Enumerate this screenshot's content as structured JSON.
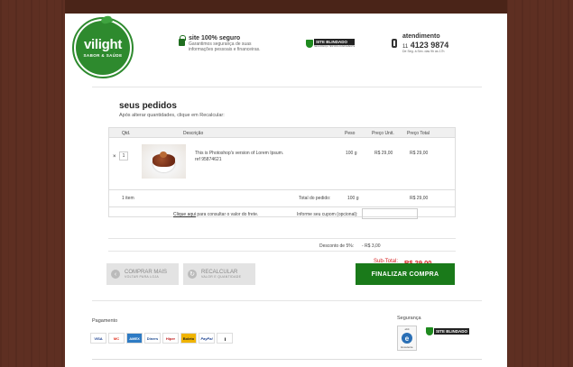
{
  "header": {
    "logo_name": "vilight",
    "logo_tagline": "SABOR & SAÚDE",
    "secure_title": "site 100% seguro",
    "secure_text": "Garantimos segurança de suas informações pessoais e financeiras.",
    "blindado_label": "SITE BLINDADO",
    "blindado_sub": "SEGURANÇA TESTADA DIARIAMENTE",
    "atendimento_title": "atendimento",
    "area_code": "11",
    "phone": "4123 9874",
    "hours": "De Seg. à Sex. das 9h às 17h"
  },
  "cart": {
    "title": "seus pedidos",
    "subtitle": "Após alterar quantidades, clique em Recalcular:",
    "columns": {
      "qtd": "Qtd.",
      "descricao": "Descrição",
      "peso": "Peso",
      "preco_unit": "Preço Unit.",
      "preco_total": "Preço Total"
    },
    "items": [
      {
        "remove": "×",
        "qty": "1",
        "description": "This is Photoshop's version  of Lorem Ipsum.",
        "ref": "ref 95874621",
        "weight": "100 g",
        "unit_price": "R$ 29,00",
        "total_price": "R$ 29,00"
      }
    ],
    "totals": {
      "count": "1 item",
      "label": "Total do pedido:",
      "weight": "100 g",
      "price": "R$ 29,00"
    },
    "freight_link": "Clique aqui",
    "freight_text": " para consultar o valor do frete.",
    "coupon_label": "Informe seu cupom (opcional):",
    "coupon_value": "",
    "discount_label": "Desconto de 5%:",
    "discount_value": "- R$ 3,00",
    "subtotal_label": "Sub-Total:",
    "subtotal_value": "R$ 29,00"
  },
  "actions": {
    "continue_title": "COMPRAR MAIS",
    "continue_sub": "VOLTAR PARA LOJA",
    "recalc_title": "RECALCULAR",
    "recalc_sub": "VALOR E QUANTIDADE",
    "finalize": "FINALIZAR  COMPRA"
  },
  "footer": {
    "payment_title": "Pagamento",
    "cards": [
      "VISA",
      "MC",
      "AMEX",
      "Diners",
      "Hiper",
      "Boleto",
      "PayPal",
      "|||||"
    ],
    "security_title": "Segurança",
    "ebit_head": "ebit",
    "ebit_letter": "e",
    "ebit_foot": "Excelente",
    "blindado_label": "SITE BLINDADO"
  },
  "colors": {
    "brand_green": "#1a7a1a",
    "accent_red": "#d62020",
    "wood": "#5e2f22"
  }
}
